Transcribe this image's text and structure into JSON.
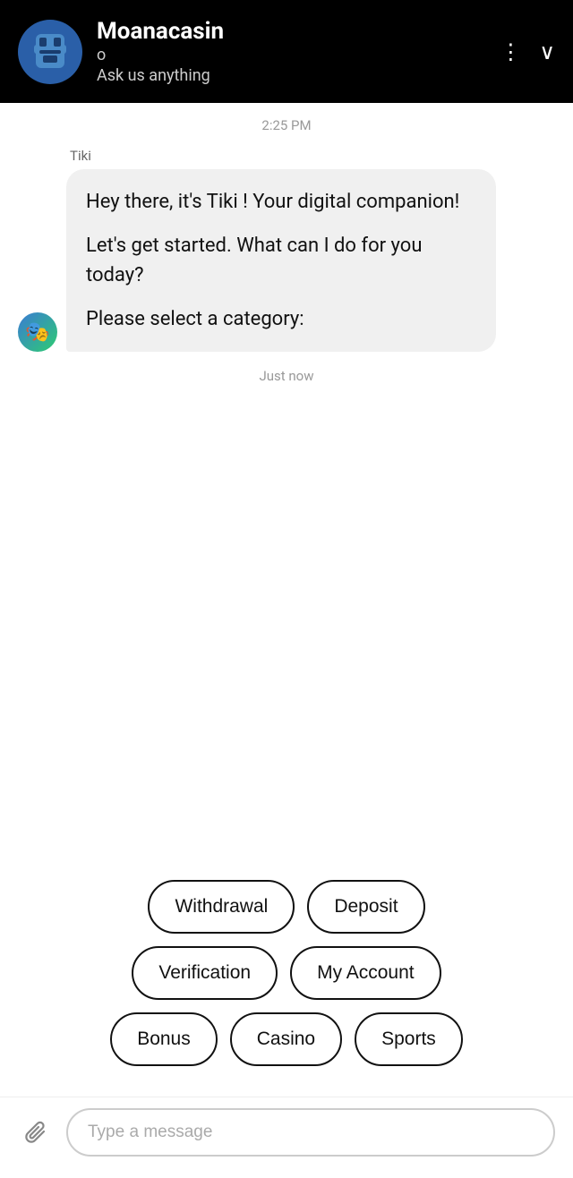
{
  "header": {
    "name": "Moanacasin",
    "status": "o",
    "subtitle": "Ask us anything",
    "more_icon": "⋮",
    "collapse_icon": "∨"
  },
  "chat": {
    "timestamp_top": "2:25 PM",
    "sender_name": "Tiki",
    "message_part1": "Hey there, it's Tiki ! Your digital companion!",
    "message_part2": "Let's get started. What can I do for you today?",
    "message_part3": "Please select a category:",
    "timestamp_bottom": "Just now"
  },
  "categories": {
    "row1": [
      {
        "label": "Withdrawal",
        "name": "withdrawal-btn"
      },
      {
        "label": "Deposit",
        "name": "deposit-btn"
      }
    ],
    "row2": [
      {
        "label": "Verification",
        "name": "verification-btn"
      },
      {
        "label": "My Account",
        "name": "my-account-btn"
      }
    ],
    "row3": [
      {
        "label": "Bonus",
        "name": "bonus-btn"
      },
      {
        "label": "Casino",
        "name": "casino-btn"
      },
      {
        "label": "Sports",
        "name": "sports-btn"
      }
    ]
  },
  "input": {
    "placeholder": "Type a message",
    "attach_icon": "📎"
  }
}
